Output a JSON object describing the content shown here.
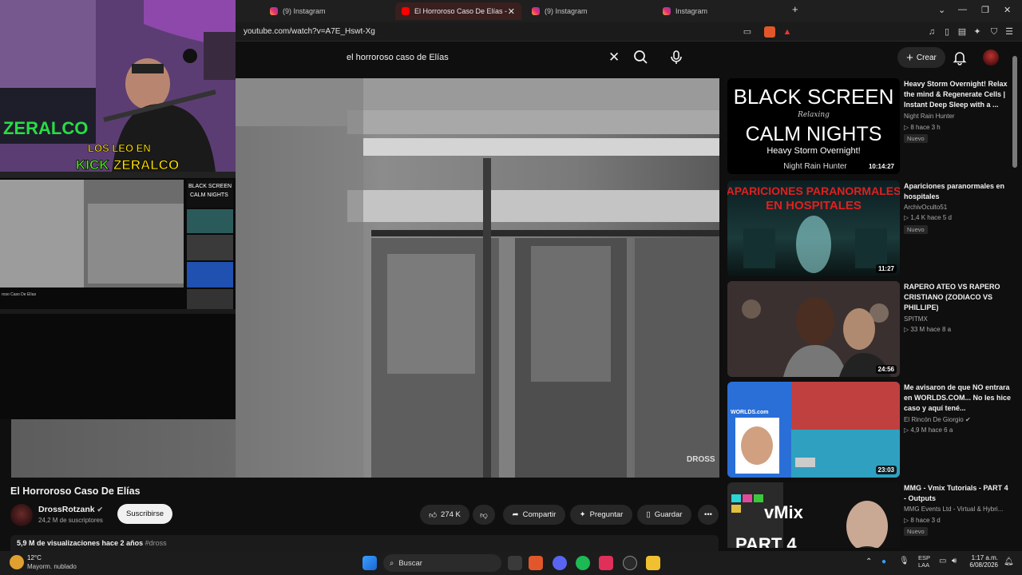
{
  "browser": {
    "tabs": [
      {
        "label": "(9) Instagram",
        "icon": "instagram-icon",
        "active": false
      },
      {
        "label": "El Horroroso Caso De Elías - You",
        "icon": "youtube-icon",
        "active": true
      },
      {
        "label": "(9) Instagram",
        "icon": "instagram-icon",
        "active": false
      },
      {
        "label": "Instagram",
        "icon": "instagram-icon",
        "active": false
      }
    ],
    "new_tab": "+",
    "url": "youtube.com/watch?v=A7E_Hswt-Xg"
  },
  "overlay": {
    "banner_line1": "LOS LEO EN",
    "banner_kick": "KICK",
    "banner_name": "ZERALCO",
    "neon": "ZERALCO",
    "mini_thumb_text1": "BLACK SCREEN",
    "mini_thumb_text2": "CALM NIGHTS",
    "mini_title": "roso Caso De Elías"
  },
  "youtube": {
    "search_query": "el horroroso caso de Elías",
    "create_label": "Crear",
    "video": {
      "title": "El Horroroso Caso De Elías",
      "channel": "DrossRotzank",
      "subscribers": "24,2 M de suscriptores",
      "subscribe_label": "Suscribirse",
      "likes": "274 K",
      "share_label": "Compartir",
      "ask_label": "Preguntar",
      "save_label": "Guardar",
      "views": "5,9 M de visualizaciones  hace 2 años",
      "hashtag": "#dross",
      "watermark": "DROSS"
    },
    "recommendations": [
      {
        "title": "Heavy Storm Overnight! Relax the mind & Regenerate Cells | Instant Deep Sleep with a ...",
        "channel": "Night Rain Hunter",
        "meta": "8  hace 3 h",
        "badge": "Nuevo",
        "duration": "10:14:27",
        "thumb_text": [
          "BLACK SCREEN",
          "Relaxing",
          "CALM NIGHTS",
          "Heavy Storm Overnight!",
          "Night Rain Hunter"
        ]
      },
      {
        "title": "Apariciones paranormales en hospitales",
        "channel": "ArchivOculto51",
        "meta": "1,4 K  hace 5 d",
        "badge": "Nuevo",
        "duration": "11:27",
        "thumb_text": [
          "APARICIONES PARANORMALES",
          "EN HOSPITALES"
        ]
      },
      {
        "title": "RAPERO ATEO VS RAPERO CRISTIANO (ZODIACO VS PHILLIPE)",
        "channel": "SPITMX",
        "meta": "33 M  hace 8 a",
        "badge": "",
        "duration": "24:56",
        "thumb_text": []
      },
      {
        "title": "Me avisaron de que NO entrara en WORLDS.COM... No les hice caso y aquí tené...",
        "channel": "El Rincón De Giorgio",
        "meta": "4,9 M  hace 6 a",
        "badge": "",
        "duration": "23:03",
        "thumb_text": [
          "WORLDS.com"
        ]
      },
      {
        "title": "MMG - Vmix Tutorials - PART 4 - Outputs",
        "channel": "MMG Events Ltd - Virtual & Hybri...",
        "meta": "8  hace 3 d",
        "badge": "Nuevo",
        "duration": "",
        "thumb_text": [
          "vMix",
          "PART 4"
        ]
      }
    ]
  },
  "taskbar": {
    "weather_temp": "12°C",
    "weather_desc": "Mayorm. nublado",
    "search_label": "Buscar",
    "lang1": "ESP",
    "lang2": "LAA",
    "time": "1:17 a.m.",
    "date": "6/08/2026"
  },
  "colors": {
    "accent": "#ff0000",
    "bg": "#0f0f0f",
    "chip": "#272727"
  }
}
